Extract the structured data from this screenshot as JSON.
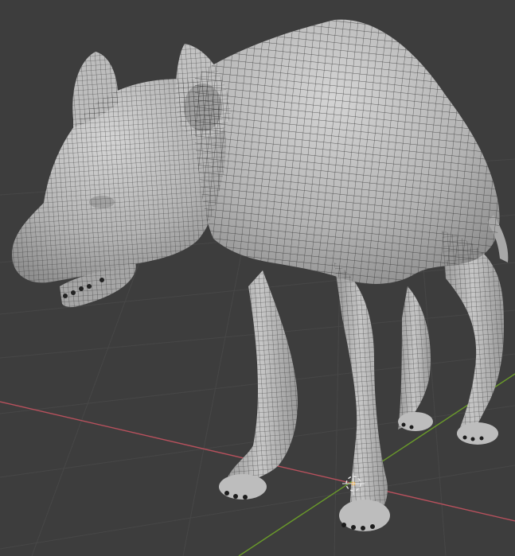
{
  "viewport": {
    "background": "#3d3d3d",
    "grid_color": "#474747",
    "x_axis_color": "#b8515d",
    "y_axis_color": "#6a9a2a",
    "origin_color": "#e5a33b"
  },
  "model": {
    "mesh_fill": "#b9b9b9",
    "mesh_shadow": "#8f8f8f",
    "wire_color": "#2a2a2a",
    "claw_color": "#1c1c1c"
  }
}
